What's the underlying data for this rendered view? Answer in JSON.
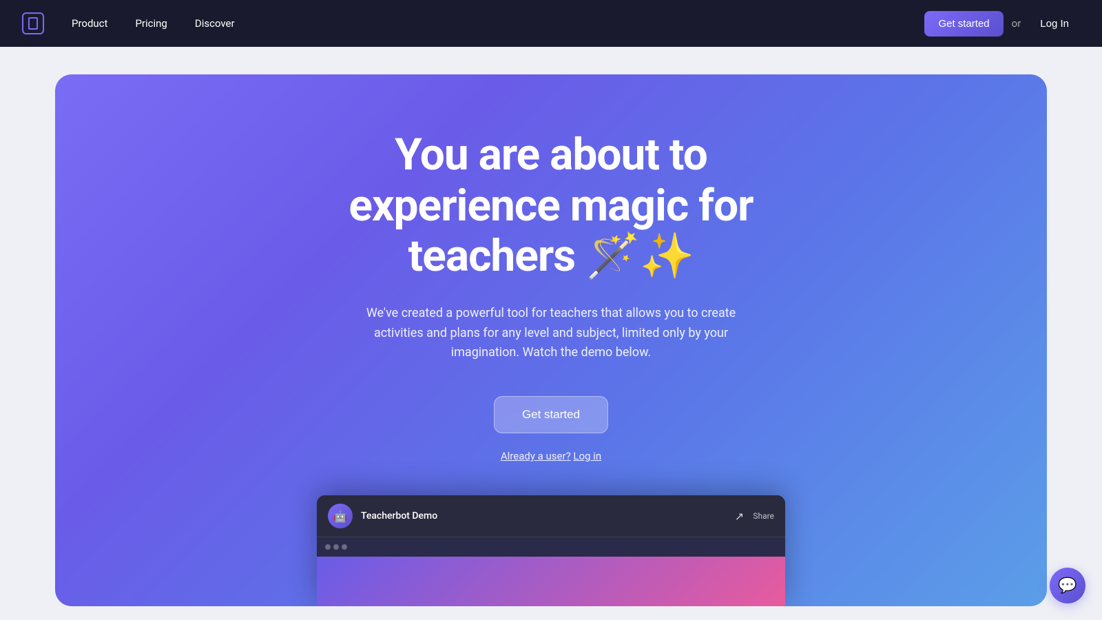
{
  "navbar": {
    "logo_label": "Logo",
    "nav_items": [
      {
        "label": "Product",
        "id": "product"
      },
      {
        "label": "Pricing",
        "id": "pricing"
      },
      {
        "label": "Discover",
        "id": "discover"
      }
    ],
    "get_started_label": "Get started",
    "or_label": "or",
    "login_label": "Log In"
  },
  "hero": {
    "title_line1": "You are about to",
    "title_line2": "experience magic for",
    "title_line3": "teachers",
    "title_emoji": "🪄✨",
    "subtitle": "We've created a powerful tool for teachers that allows you to create activities and plans for any level and subject, limited only by your imagination. Watch the demo below.",
    "get_started_label": "Get started",
    "already_user_text": "Already a user?",
    "login_link": "Log in"
  },
  "video_preview": {
    "avatar_emoji": "🤖",
    "title": "Teacherbot Demo",
    "share_label": "Share"
  },
  "chat_widget": {
    "icon": "💬"
  }
}
